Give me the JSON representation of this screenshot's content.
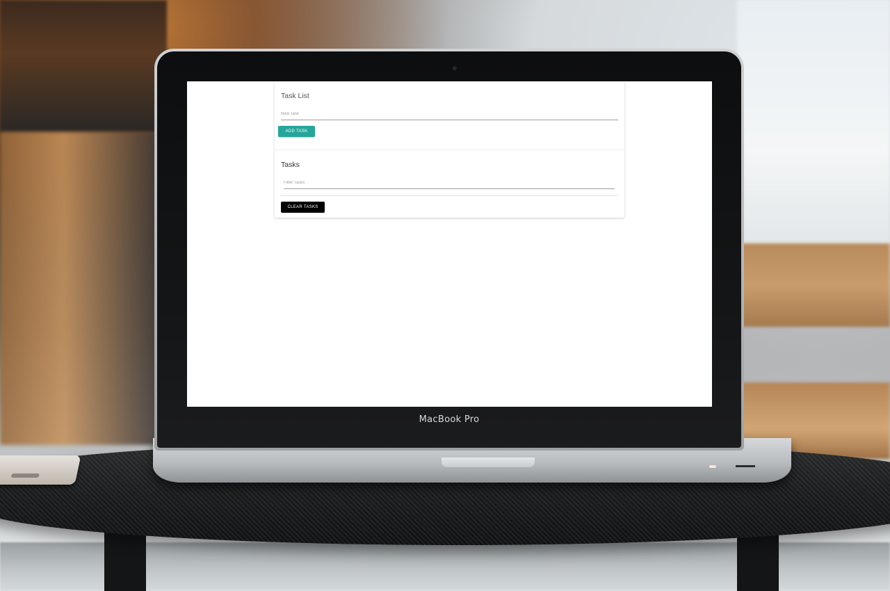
{
  "device": {
    "brand_label": "MacBook Pro"
  },
  "app": {
    "add_section": {
      "title": "Task List",
      "new_task_input": {
        "placeholder": "New Task",
        "value": ""
      },
      "add_button_label": "ADD TASK"
    },
    "tasks_section": {
      "title": "Tasks",
      "filter_input": {
        "placeholder": "Filter Tasks",
        "value": ""
      },
      "clear_button_label": "CLEAR TASKS"
    }
  },
  "colors": {
    "add_button": "#26a69a",
    "clear_button": "#000000",
    "screen_background": "#ffffff"
  }
}
